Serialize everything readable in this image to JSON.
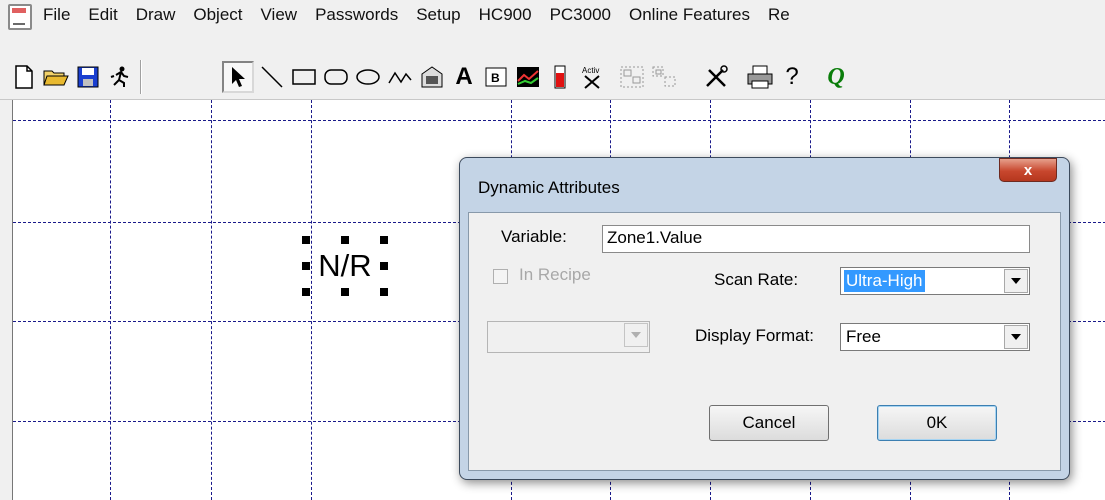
{
  "menubar": {
    "items": [
      "File",
      "Edit",
      "Draw",
      "Object",
      "View",
      "Passwords",
      "Setup",
      "HC900",
      "PC3000",
      "Online Features",
      "Re"
    ]
  },
  "toolbar": {
    "icons": [
      "new-file-icon",
      "open-folder-icon",
      "save-icon",
      "run-icon",
      "select-arrow-icon",
      "line-icon",
      "rectangle-icon",
      "rounded-rectangle-icon",
      "ellipse-icon",
      "polyline-icon",
      "bitmap-icon",
      "text-icon",
      "button-icon",
      "trend-icon",
      "bar-icon",
      "activex-icon",
      "group-icon",
      "ungroup-icon",
      "tools-icon",
      "print-icon",
      "help-icon",
      "q-icon"
    ]
  },
  "canvas": {
    "object_text": "N/R"
  },
  "dialog": {
    "title": "Dynamic Attributes",
    "close_label": "x",
    "variable_label": "Variable:",
    "variable_value": "Zone1.Value",
    "in_recipe_label": "In Recipe",
    "scan_rate_label": "Scan Rate:",
    "scan_rate_value": "Ultra-High",
    "display_format_label": "Display Format:",
    "display_format_value": "Free",
    "cancel_label": "Cancel",
    "ok_label": "0K"
  },
  "colors": {
    "grid": "#1a1a8a",
    "selection": "#3399ff",
    "dialog_frame": "#c4d4e6",
    "close_button": "#c8472e"
  }
}
